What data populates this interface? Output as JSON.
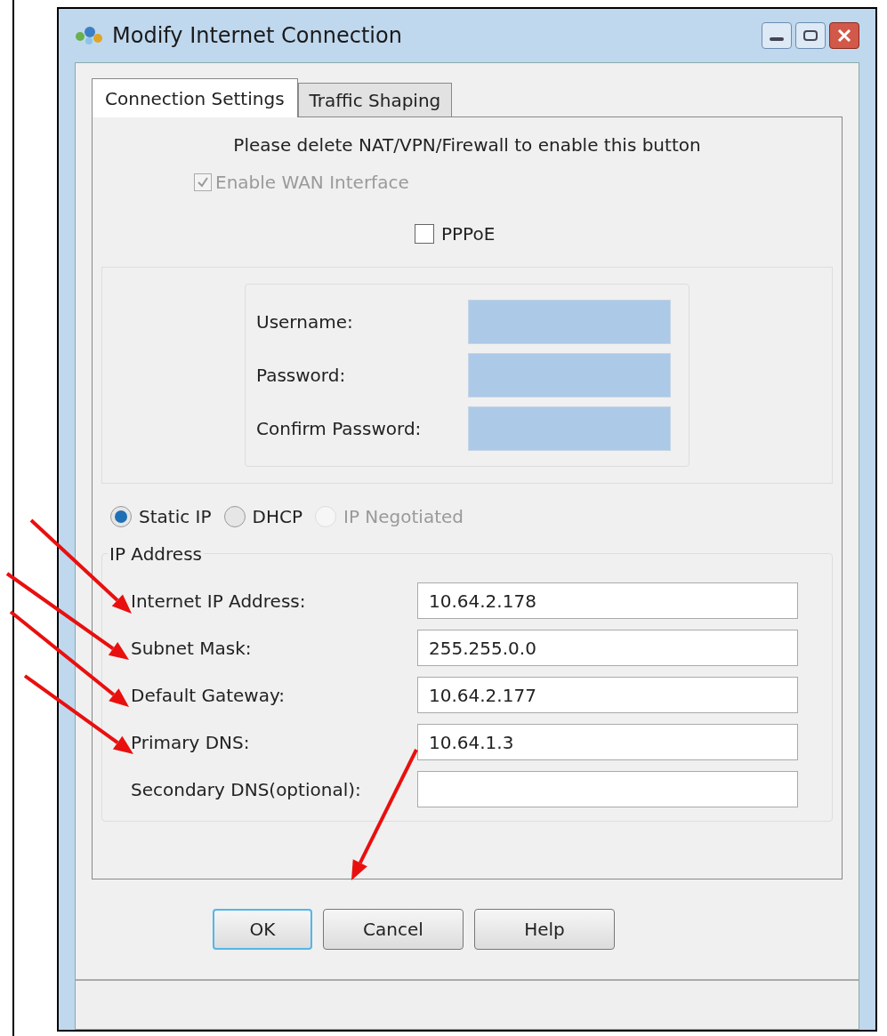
{
  "window": {
    "title": "Modify Internet Connection"
  },
  "tabs": [
    {
      "label": "Connection Settings",
      "selected": true
    },
    {
      "label": "Traffic Shaping",
      "selected": false
    }
  ],
  "notice": "Please delete NAT/VPN/Firewall to enable this button",
  "enable_wan": {
    "label": "Enable WAN Interface",
    "checked": true,
    "disabled": true
  },
  "pppoe": {
    "label": "PPPoE",
    "checked": false,
    "fields": [
      {
        "label": "Username:",
        "disabled": true
      },
      {
        "label": "Password:",
        "disabled": true
      },
      {
        "label": "Confirm Password:",
        "disabled": true
      }
    ]
  },
  "ip_modes": [
    {
      "label": "Static IP",
      "selected": true,
      "disabled": false
    },
    {
      "label": "DHCP",
      "selected": false,
      "disabled": false
    },
    {
      "label": "IP Negotiated",
      "selected": false,
      "disabled": true
    }
  ],
  "ip_address": {
    "title": "IP Address",
    "fields": [
      {
        "label": "Internet IP Address:",
        "value": "10.64.2.178"
      },
      {
        "label": "Subnet Mask:",
        "value": "255.255.0.0"
      },
      {
        "label": "Default Gateway:",
        "value": "10.64.2.177"
      },
      {
        "label": "Primary DNS:",
        "value": "10.64.1.3"
      },
      {
        "label": "Secondary DNS(optional):"
      }
    ]
  },
  "buttons": [
    {
      "label": "OK",
      "focused": true
    },
    {
      "label": "Cancel",
      "focused": false
    },
    {
      "label": "Help",
      "focused": false
    }
  ]
}
